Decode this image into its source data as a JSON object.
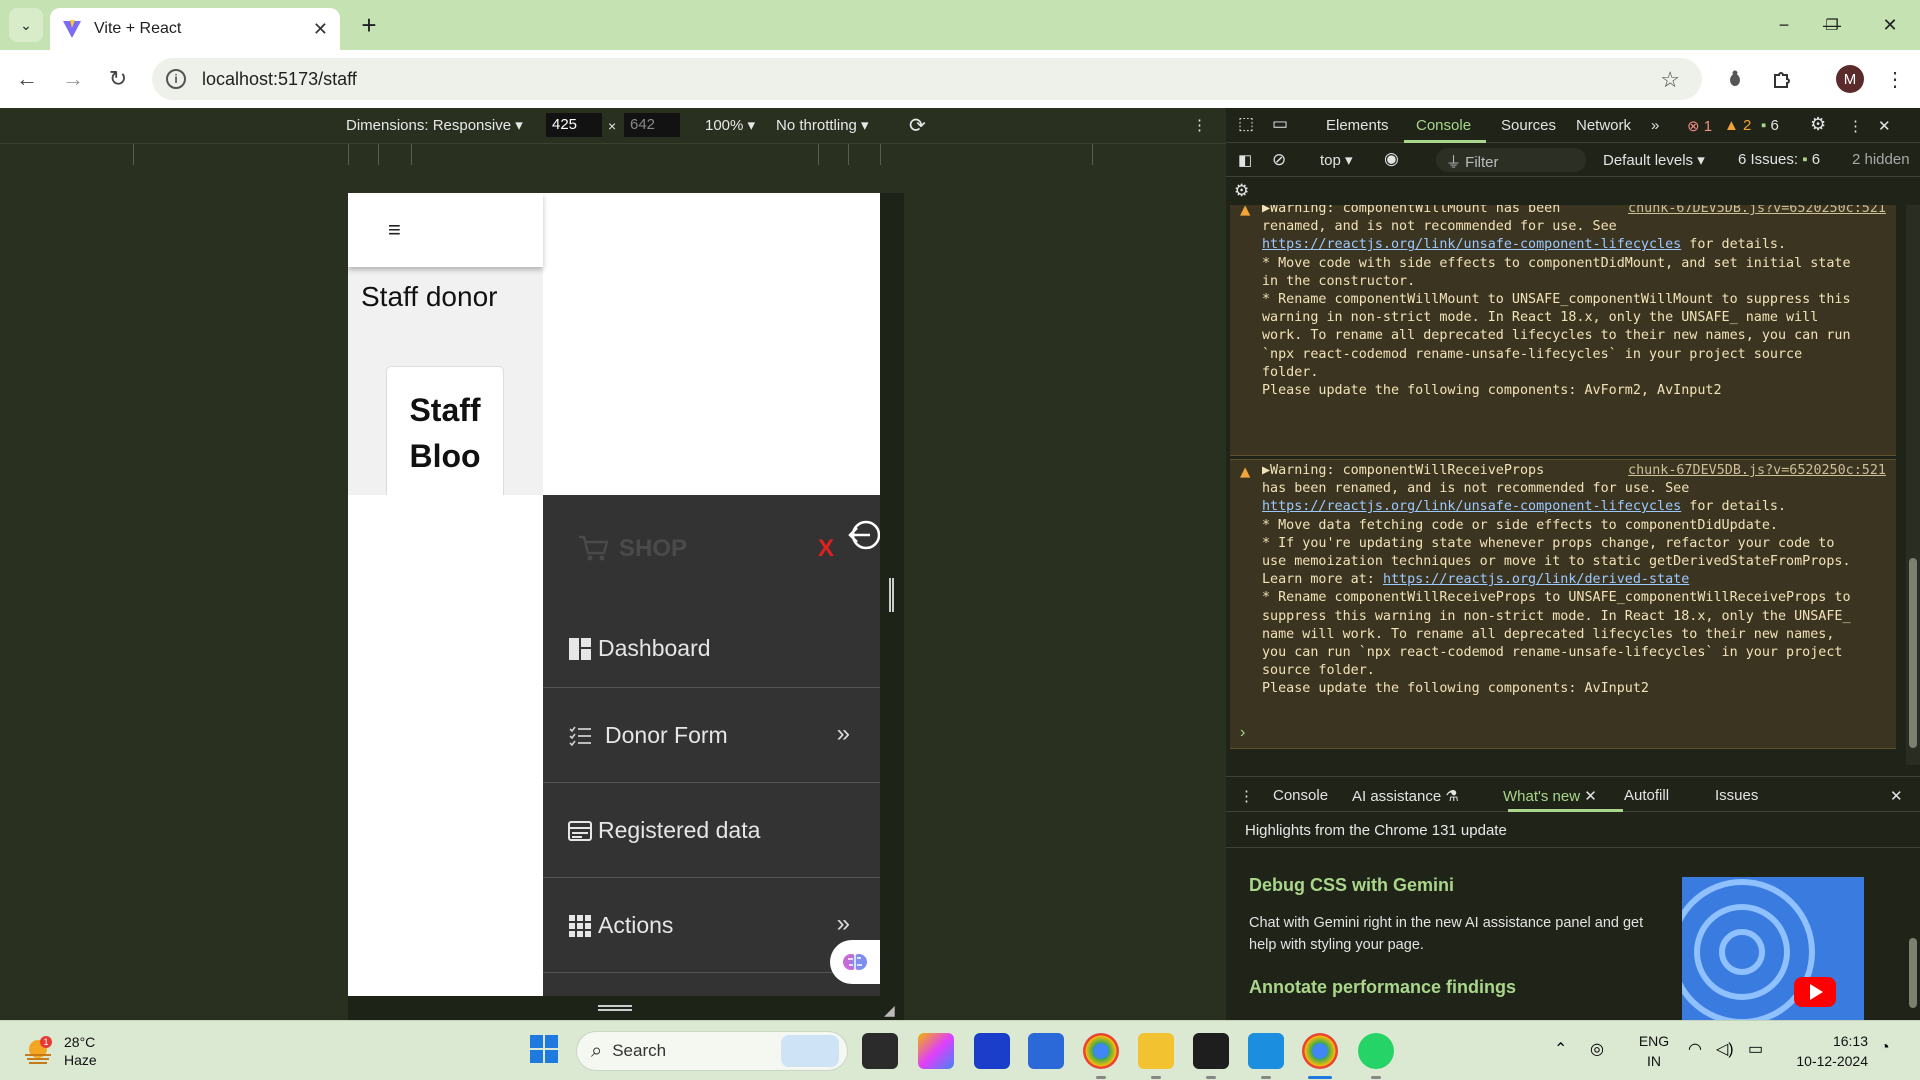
{
  "browser": {
    "tab_title": "Vite + React",
    "url": "localhost:5173/staff",
    "profile_initial": "M"
  },
  "device_toolbar": {
    "dimensions_label": "Dimensions: Responsive",
    "width": "425",
    "times": "×",
    "height": "642",
    "zoom": "100%",
    "throttling": "No throttling"
  },
  "page": {
    "title": "Staff donor",
    "card_line1": "Staff",
    "card_line2": "Bloo",
    "sidebar": {
      "brand": "SHOP",
      "close": "X",
      "items": [
        {
          "label": "Dashboard",
          "icon": "dashboard-icon",
          "chevron": ""
        },
        {
          "label": "Donor Form",
          "icon": "list-icon",
          "chevron": "»"
        },
        {
          "label": "Registered data",
          "icon": "card-icon",
          "chevron": ""
        },
        {
          "label": "Actions",
          "icon": "grid-icon",
          "chevron": "»"
        }
      ]
    }
  },
  "devtools": {
    "tabs": [
      "Elements",
      "Console",
      "Sources",
      "Network"
    ],
    "active_tab": "Console",
    "errors": "1",
    "warnings": "2",
    "messages": "6",
    "context": "top",
    "filter_placeholder": "Filter",
    "levels": "Default levels",
    "issues_label": "6 Issues:",
    "issues_count": "6",
    "hidden": "2 hidden",
    "warning1": {
      "source": "chunk-67DEV5DB.js?v=6520250c:521",
      "lines": [
        "▶Warning: componentWillMount has been",
        "renamed, and is not recommended for use. See",
        "https://reactjs.org/link/unsafe-component-lifecycles",
        " for details.",
        "",
        "* Move code with side effects to componentDidMount, and set initial state",
        "in the constructor.",
        "* Rename componentWillMount to UNSAFE_componentWillMount to suppress this",
        "warning in non-strict mode. In React 18.x, only the UNSAFE_ name will",
        "work. To rename all deprecated lifecycles to their new names, you can run",
        "`npx react-codemod rename-unsafe-lifecycles` in your project source",
        "folder.",
        "",
        "Please update the following components: AvForm2, AvInput2"
      ]
    },
    "warning2": {
      "source": "chunk-67DEV5DB.js?v=6520250c:521",
      "lines": [
        "▶Warning: componentWillReceiveProps",
        "has been renamed, and is not recommended for use. See",
        "https://reactjs.org/link/unsafe-component-lifecycles",
        " for details.",
        "",
        "* Move data fetching code or side effects to componentDidUpdate.",
        "* If you're updating state whenever props change, refactor your code to",
        "use memoization techniques or move it to static getDerivedStateFromProps.",
        "Learn more at: ",
        "https://reactjs.org/link/derived-state",
        "* Rename componentWillReceiveProps to UNSAFE_componentWillReceiveProps to",
        "suppress this warning in non-strict mode. In React 18.x, only the UNSAFE_",
        "name will work. To rename all deprecated lifecycles to their new names,",
        "you can run `npx react-codemod rename-unsafe-lifecycles` in your project",
        "source folder.",
        "",
        "Please update the following components: AvInput2"
      ]
    },
    "prompt": "›",
    "drawer_tabs": [
      "Console",
      "AI assistance",
      "What's new",
      "Autofill",
      "Issues"
    ],
    "drawer_active": "What's new",
    "whatsnew_header": "Highlights from the Chrome 131 update",
    "whatsnew_h1": "Debug CSS with Gemini",
    "whatsnew_p": "Chat with Gemini right in the new AI assistance panel and get help with styling your page.",
    "whatsnew_h2": "Annotate performance findings"
  },
  "taskbar": {
    "weather_temp": "28°C",
    "weather_desc": "Haze",
    "weather_badge": "1",
    "search_label": "Search",
    "lang1": "ENG",
    "lang2": "IN",
    "time": "16:13",
    "date": "10-12-2024"
  },
  "colors": {
    "titlebar": "#c5e2b3",
    "devtools_bg": "#202318",
    "accent": "#a9d68b",
    "sidebar_bg": "#333333",
    "shop_close": "#e02020"
  }
}
